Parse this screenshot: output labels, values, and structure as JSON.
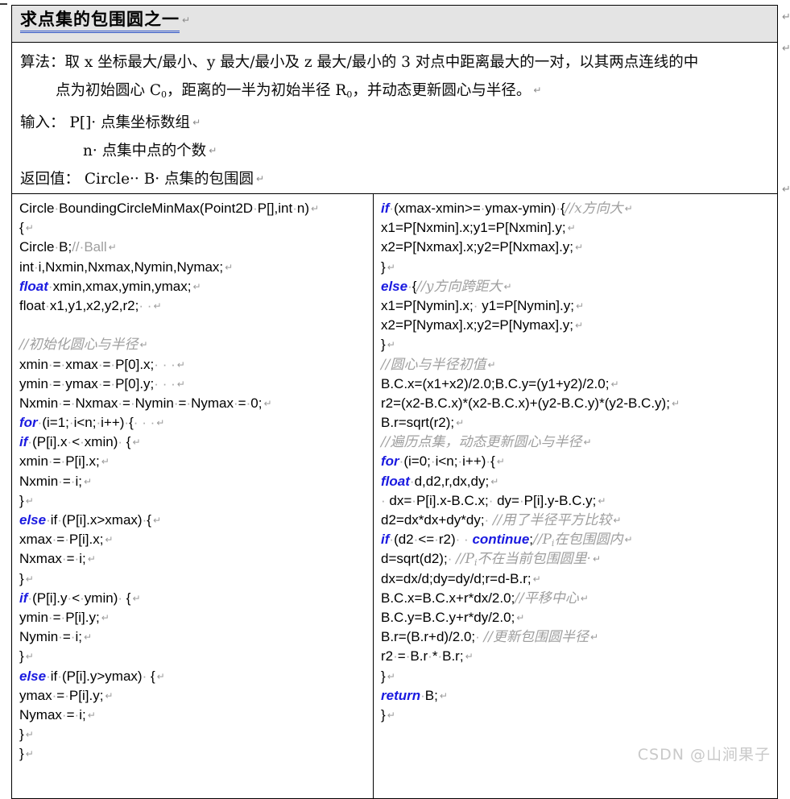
{
  "document": {
    "title": "求点集的包围圆之一",
    "title_return_mark": "↵",
    "watermark": "CSDN @山涧果子"
  },
  "description": {
    "lines": [
      "算法：取 x 坐标最大/最小、y 最大/最小及 z 最大/最小的 3 对点中距离最大的一对，以其两点连线的中",
      "点为初始圆心 C0，距离的一半为初始半径 R0，并动态更新圆心与半径。",
      "输入： P[]· 点集坐标数组",
      "n· 点集中点的个数",
      "返回值： Circle·· B· 点集的包围圆"
    ],
    "line1": "算法：取 x 坐标最大/最小、y 最大/最小及 z 最大/最小的 3 对点中距离最大的一对，以其两点连线的中",
    "line2_a": "点为初始圆心 C",
    "line2_sub1": "0",
    "line2_b": "，距离的一半为初始半径 R",
    "line2_sub2": "0",
    "line2_c": "，并动态更新圆心与半径。",
    "line3_label": "输入：",
    "line3_text": "P[]· 点集坐标数组",
    "line4_text": "n· 点集中点的个数",
    "line5_label": "返回值：",
    "line5_text": "Circle·· B· 点集的包围圆"
  },
  "code_left": {
    "lines": [
      "Circle·BoundingCircleMinMax(Point2D·P[],int·n)",
      "{",
      "Circle·B;//·Ball",
      "        int·i,Nxmin,Nxmax,Nymin,Nymax;",
      "float·xmin,xmax,ymin,ymax;",
      "        float·x1,y1,x2,y2,r2;· ·",
      "",
      "//初始化圆心与半径",
      "xmin·=·xmax·=·P[0].x;· · ·",
      "ymin·=·ymax·=·P[0].y;· · ·",
      "Nxmin·=·Nxmax·=·Nymin·=·Nymax·=·0;",
      "for·(i=1;·i<n;·i++)·{· · ·",
      "if·(P[i].x·<·xmin)· {",
      "xmin·=·P[i].x;",
      "Nxmin·=·i;",
      "}",
      "else·if·(P[i].x>xmax)·{",
      "xmax·=·P[i].x;",
      "Nxmax·=·i;",
      "}",
      "if·(P[i].y·<·ymin)· {",
      "ymin·=·P[i].y;",
      "Nymin·=·i;",
      "}",
      "else·if·(P[i].y>ymax)· {",
      "ymax·=·P[i].y;",
      "Nymax·=·i;",
      "}",
      "}"
    ]
  },
  "code_right": {
    "lines": [
      "if·(xmax-xmin>=·ymax-ymin)·{//x方向大",
      "x1=P[Nxmin].x;y1=P[Nxmin].y;",
      "x2=P[Nxmax].x;y2=P[Nxmax].y;",
      "}",
      "else·{//y方向跨距大",
      "x1=P[Nymin].x;· y1=P[Nymin].y;",
      "x2=P[Nymax].x;y2=P[Nymax].y;",
      "}",
      "//圆心与半径初值",
      "B.C.x=(x1+x2)/2.0;B.C.y=(y1+y2)/2.0;",
      "r2=(x2-B.C.x)*(x2-B.C.x)+(y2-B.C.y)*(y2-B.C.y);",
      "B.r=sqrt(r2);",
      "//遍历点集，动态更新圆心与半径",
      "for·(i=0;·i<n;·i++)·{",
      "float·d,d2,r,dx,dy;",
      "· dx=·P[i].x-B.C.x;· dy=·P[i].y-B.C.y;",
      "d2=dx*dx+dy*dy;· //用了半径平方比较",
      "if·(d2·<=·r2)· · continue;//Pi在包围圆内",
      "d=sqrt(d2);· //Pi不在当前包围圆里·",
      "dx=dx/d;dy=dy/d;r=d-B.r;",
      "B.C.x=B.C.x+r*dx/2.0;//平移中心",
      "B.C.y=B.C.y+r*dy/2.0;",
      "B.r=(B.r+d)/2.0;· //更新包围圆半径",
      "r2·=·B.r·*·B.r;",
      "}",
      "return·B;",
      "}"
    ]
  },
  "margin_marks": {
    "mark": "↵",
    "count": 3
  },
  "colors": {
    "keyword": "#1a1ae0",
    "comment": "#9e9e9e",
    "header_bg": "#e4e4e4",
    "title_underline": "#2f54c8",
    "watermark": "#c9c9c9",
    "border": "#000000"
  }
}
